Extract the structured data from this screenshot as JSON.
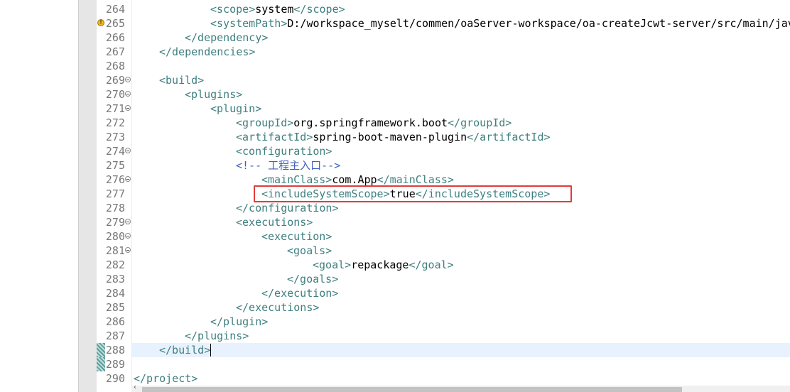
{
  "editor": {
    "lines": [
      {
        "num": "264",
        "fold": false,
        "segments": [
          {
            "t": "<",
            "c": "tag"
          },
          {
            "t": "scope",
            "c": "tag"
          },
          {
            "t": ">",
            "c": "tag"
          },
          {
            "t": "system",
            "c": "text"
          },
          {
            "t": "</",
            "c": "tag"
          },
          {
            "t": "scope",
            "c": "tag"
          },
          {
            "t": ">",
            "c": "tag"
          }
        ],
        "indent": 3
      },
      {
        "num": "265",
        "fold": false,
        "warning": true,
        "segments": [
          {
            "t": "<systemPath>",
            "c": "tag"
          },
          {
            "t": "D:/workspace_myselt/commen/oaServer-workspace/oa-createJcwt-server/src/main/jav",
            "c": "text"
          }
        ],
        "indent": 3
      },
      {
        "num": "266",
        "fold": false,
        "segments": [
          {
            "t": "</dependency>",
            "c": "tag"
          }
        ],
        "indent": 2
      },
      {
        "num": "267",
        "fold": false,
        "segments": [
          {
            "t": "</dependencies>",
            "c": "tag"
          }
        ],
        "indent": 1
      },
      {
        "num": "268",
        "fold": false,
        "segments": [],
        "indent": 0
      },
      {
        "num": "269",
        "fold": true,
        "segments": [
          {
            "t": "<build>",
            "c": "tag"
          }
        ],
        "indent": 1
      },
      {
        "num": "270",
        "fold": true,
        "segments": [
          {
            "t": "<plugins>",
            "c": "tag"
          }
        ],
        "indent": 2
      },
      {
        "num": "271",
        "fold": true,
        "segments": [
          {
            "t": "<plugin>",
            "c": "tag"
          }
        ],
        "indent": 3
      },
      {
        "num": "272",
        "fold": false,
        "segments": [
          {
            "t": "<groupId>",
            "c": "tag"
          },
          {
            "t": "org.springframework.boot",
            "c": "text"
          },
          {
            "t": "</groupId>",
            "c": "tag"
          }
        ],
        "indent": 4
      },
      {
        "num": "273",
        "fold": false,
        "segments": [
          {
            "t": "<artifactId>",
            "c": "tag"
          },
          {
            "t": "spring-boot-maven-plugin",
            "c": "text"
          },
          {
            "t": "</artifactId>",
            "c": "tag"
          }
        ],
        "indent": 4
      },
      {
        "num": "274",
        "fold": true,
        "segments": [
          {
            "t": "<configuration>",
            "c": "tag"
          }
        ],
        "indent": 4
      },
      {
        "num": "275",
        "fold": false,
        "segments": [
          {
            "t": "<!-- 工程主入口-->",
            "c": "comment"
          }
        ],
        "indent": 4
      },
      {
        "num": "276",
        "fold": true,
        "segments": [
          {
            "t": "<mainClass>",
            "c": "tag"
          },
          {
            "t": "com.App",
            "c": "text"
          },
          {
            "t": "</mainClass>",
            "c": "tag"
          }
        ],
        "indent": 5
      },
      {
        "num": "277",
        "fold": false,
        "segments": [
          {
            "t": "<includeSystemScope>",
            "c": "tag"
          },
          {
            "t": "true",
            "c": "text"
          },
          {
            "t": "</includeSystemScope>",
            "c": "tag"
          }
        ],
        "indent": 5
      },
      {
        "num": "278",
        "fold": false,
        "segments": [
          {
            "t": "</configuration>",
            "c": "tag"
          }
        ],
        "indent": 4
      },
      {
        "num": "279",
        "fold": true,
        "segments": [
          {
            "t": "<executions>",
            "c": "tag"
          }
        ],
        "indent": 4
      },
      {
        "num": "280",
        "fold": true,
        "segments": [
          {
            "t": "<execution>",
            "c": "tag"
          }
        ],
        "indent": 5
      },
      {
        "num": "281",
        "fold": true,
        "segments": [
          {
            "t": "<goals>",
            "c": "tag"
          }
        ],
        "indent": 6
      },
      {
        "num": "282",
        "fold": false,
        "segments": [
          {
            "t": "<goal>",
            "c": "tag"
          },
          {
            "t": "repackage",
            "c": "text"
          },
          {
            "t": "</goal>",
            "c": "tag"
          }
        ],
        "indent": 7
      },
      {
        "num": "283",
        "fold": false,
        "segments": [
          {
            "t": "</goals>",
            "c": "tag"
          }
        ],
        "indent": 6
      },
      {
        "num": "284",
        "fold": false,
        "segments": [
          {
            "t": "</execution>",
            "c": "tag"
          }
        ],
        "indent": 5
      },
      {
        "num": "285",
        "fold": false,
        "segments": [
          {
            "t": "</executions>",
            "c": "tag"
          }
        ],
        "indent": 4
      },
      {
        "num": "286",
        "fold": false,
        "segments": [
          {
            "t": "</plugin>",
            "c": "tag"
          }
        ],
        "indent": 3
      },
      {
        "num": "287",
        "fold": false,
        "segments": [
          {
            "t": "</plugins>",
            "c": "tag"
          }
        ],
        "indent": 2
      },
      {
        "num": "288",
        "fold": false,
        "current": true,
        "changed": true,
        "segments": [
          {
            "t": "</build>",
            "c": "tag"
          }
        ],
        "indent": 1
      },
      {
        "num": "289",
        "fold": false,
        "changed": true,
        "segments": [],
        "indent": 0
      },
      {
        "num": "290",
        "fold": false,
        "segments": [
          {
            "t": "</project>",
            "c": "tag"
          }
        ],
        "indent": 0
      }
    ]
  },
  "colors": {
    "tag": "#3f7f7f",
    "comment": "#3f5fbf",
    "text": "#000000",
    "highlight_box": "#e03c3c",
    "current_line": "#e8f2fe"
  },
  "icons": {
    "fold_marker": "collapse-icon",
    "warning_marker": "warning-icon",
    "scroll_left": "chevron-left-icon"
  }
}
